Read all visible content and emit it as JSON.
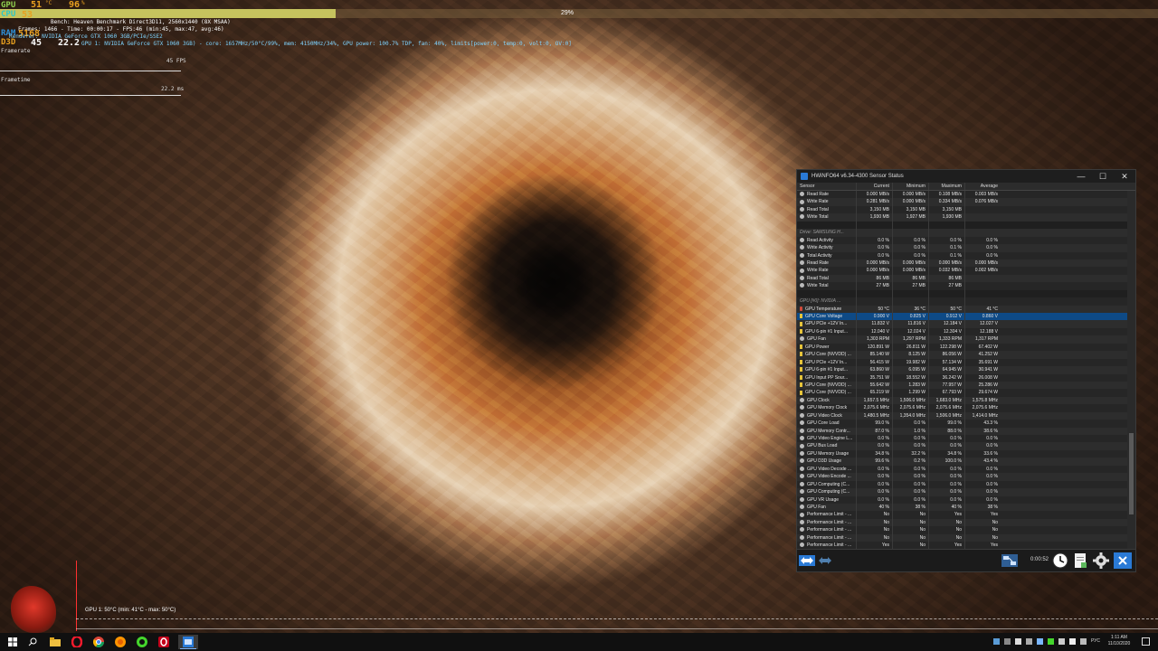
{
  "osd": {
    "gpu_label": "GPU",
    "gpu_value": "51",
    "gpu_unit": "°C",
    "gpu_value2": "96",
    "gpu_unit2": "%",
    "cpu_label": "CPU",
    "cpu_value": "53",
    "ram_label": "RAM",
    "ram_value": "5168",
    "fps_label": "D3D",
    "fps_value": "45",
    "fps_unit": "FPS",
    "frametime": "22.2",
    "frametime_unit": "ms",
    "line1": "Bench: Heaven Benchmark Direct3D11, 2560x1440 (8X MSAA)",
    "line2": "Frames: 1466 - Time: 00:00:17 - FPS:46 (min:45, max:47, avg:46)",
    "line3": "Renderer: NVIDIA GeForce GTX 1060 3GB/PCIe/SSE2",
    "line4": "GPU 1: NVIDIA GeForce GTX 1060 3GB) - core: 1657MHz/50°C/99%, mem: 4150MHz/34%, GPU power: 100.7% TDP, fan: 40%, limits[power:0, temp:0, volt:0, OV:0]",
    "framerate_label": "Framerate",
    "framerate_max": "45 FPS",
    "frametime_label": "Frametime",
    "frametime_max": "22.2 ms",
    "progress_pct": 29,
    "progress_label": "29%",
    "gpu_graph_label": "GPU 1: 50°C (min: 41°C - max: 50°C)"
  },
  "hwinfo": {
    "title": "HWiNFO64 v6.34-4300 Sensor Status",
    "controls": {
      "minimize": "—",
      "maximize": "☐",
      "close": "✕"
    },
    "columns": [
      "Sensor",
      "Current",
      "Minimum",
      "Maximum",
      "Average"
    ],
    "rows": [
      {
        "t": "d",
        "n": "Read Rate",
        "v": [
          "0.000 MB/s",
          "0.000 MB/s",
          "0.108 MB/s",
          "0.003 MB/s"
        ]
      },
      {
        "t": "d",
        "n": "Write Rate",
        "v": [
          "0.281 MB/s",
          "0.000 MB/s",
          "0.334 MB/s",
          "0.076 MB/s"
        ]
      },
      {
        "t": "d",
        "n": "Read Total",
        "v": [
          "3,150 MB",
          "3,150 MB",
          "3,150 MB",
          ""
        ]
      },
      {
        "t": "d",
        "n": "Write Total",
        "v": [
          "1,930 MB",
          "1,927 MB",
          "1,930 MB",
          ""
        ]
      },
      {
        "t": "b",
        "n": "",
        "v": [
          "",
          "",
          "",
          ""
        ]
      },
      {
        "t": "g",
        "n": "Drive: SAMSUNG H...",
        "v": [
          "",
          "",
          "",
          ""
        ]
      },
      {
        "t": "d",
        "n": "Read Activity",
        "v": [
          "0.0 %",
          "0.0 %",
          "0.0 %",
          "0.0 %"
        ]
      },
      {
        "t": "d",
        "n": "Write Activity",
        "v": [
          "0.0 %",
          "0.0 %",
          "0.1 %",
          "0.0 %"
        ]
      },
      {
        "t": "d",
        "n": "Total Activity",
        "v": [
          "0.0 %",
          "0.0 %",
          "0.1 %",
          "0.0 %"
        ]
      },
      {
        "t": "d",
        "n": "Read Rate",
        "v": [
          "0.000 MB/s",
          "0.000 MB/s",
          "0.000 MB/s",
          "0.000 MB/s"
        ]
      },
      {
        "t": "d",
        "n": "Write Rate",
        "v": [
          "0.000 MB/s",
          "0.000 MB/s",
          "0.032 MB/s",
          "0.002 MB/s"
        ]
      },
      {
        "t": "d",
        "n": "Read Total",
        "v": [
          "86 MB",
          "86 MB",
          "86 MB",
          ""
        ]
      },
      {
        "t": "d",
        "n": "Write Total",
        "v": [
          "27 MB",
          "27 MB",
          "27 MB",
          ""
        ]
      },
      {
        "t": "b",
        "n": "",
        "v": [
          "",
          "",
          "",
          ""
        ]
      },
      {
        "t": "g",
        "n": "GPU [#0]: NVIDIA ...",
        "v": [
          "",
          "",
          "",
          ""
        ]
      },
      {
        "t": "t",
        "n": "GPU Temperature",
        "v": [
          "50 °C",
          "36 °C",
          "50 °C",
          "41 °C"
        ]
      },
      {
        "t": "s",
        "n": "GPU Core Voltage",
        "v": [
          "0.900 V",
          "0.825 V",
          "0.912 V",
          "0.860 V"
        ]
      },
      {
        "t": "v",
        "n": "GPU PCIe +12V In...",
        "v": [
          "11.832 V",
          "11.816 V",
          "12.184 V",
          "12.027 V"
        ]
      },
      {
        "t": "v",
        "n": "GPU 6-pin #1 Input...",
        "v": [
          "12.040 V",
          "12.024 V",
          "12.304 V",
          "12.188 V"
        ]
      },
      {
        "t": "d",
        "n": "GPU Fan",
        "v": [
          "1,303 RPM",
          "1,297 RPM",
          "1,333 RPM",
          "1,317 RPM"
        ]
      },
      {
        "t": "v",
        "n": "GPU Power",
        "v": [
          "120.891 W",
          "26.811 W",
          "122.298 W",
          "67.402 W"
        ]
      },
      {
        "t": "v",
        "n": "GPU Core (NVVDD) ...",
        "v": [
          "85.140 W",
          "8.125 W",
          "86.056 W",
          "41.252 W"
        ]
      },
      {
        "t": "v",
        "n": "GPU PCIe +12V In...",
        "v": [
          "56.415 W",
          "19.982 W",
          "57.134 W",
          "35.691 W"
        ]
      },
      {
        "t": "v",
        "n": "GPU 6-pin #1 Input...",
        "v": [
          "63.860 W",
          "6.095 W",
          "64.945 W",
          "30.941 W"
        ]
      },
      {
        "t": "v",
        "n": "GPU Input PP Sour...",
        "v": [
          "35.751 W",
          "18.552 W",
          "36.242 W",
          "26.008 W"
        ]
      },
      {
        "t": "v",
        "n": "GPU Core (NVVDD) ...",
        "v": [
          "55.642 W",
          "1.283 W",
          "77.957 W",
          "25.286 W"
        ]
      },
      {
        "t": "v",
        "n": "GPU Core (NVVDD) ...",
        "v": [
          "65.219 W",
          "1.299 W",
          "67.793 W",
          "29.674 W"
        ]
      },
      {
        "t": "d",
        "n": "GPU Clock",
        "v": [
          "1,657.5 MHz",
          "1,506.0 MHz",
          "1,683.0 MHz",
          "1,575.8 MHz"
        ]
      },
      {
        "t": "d",
        "n": "GPU Memory Clock",
        "v": [
          "2,075.6 MHz",
          "2,075.6 MHz",
          "2,075.6 MHz",
          "2,075.6 MHz"
        ]
      },
      {
        "t": "d",
        "n": "GPU Video Clock",
        "v": [
          "1,480.5 MHz",
          "1,354.0 MHz",
          "1,506.0 MHz",
          "1,414.0 MHz"
        ]
      },
      {
        "t": "d",
        "n": "GPU Core Load",
        "v": [
          "99.0 %",
          "0.0 %",
          "99.0 %",
          "43.3 %"
        ]
      },
      {
        "t": "d",
        "n": "GPU Memory Contr...",
        "v": [
          "87.0 %",
          "1.0 %",
          "88.0 %",
          "38.6 %"
        ]
      },
      {
        "t": "d",
        "n": "GPU Video Engine L...",
        "v": [
          "0.0 %",
          "0.0 %",
          "0.0 %",
          "0.0 %"
        ]
      },
      {
        "t": "d",
        "n": "GPU Bus Load",
        "v": [
          "0.0 %",
          "0.0 %",
          "0.0 %",
          "0.0 %"
        ]
      },
      {
        "t": "d",
        "n": "GPU Memory Usage",
        "v": [
          "34.8 %",
          "32.2 %",
          "34.8 %",
          "33.6 %"
        ]
      },
      {
        "t": "d",
        "n": "GPU D3D Usage",
        "v": [
          "99.6 %",
          "0.2 %",
          "100.0 %",
          "43.4 %"
        ]
      },
      {
        "t": "d",
        "n": "GPU Video Decode ...",
        "v": [
          "0.0 %",
          "0.0 %",
          "0.0 %",
          "0.0 %"
        ]
      },
      {
        "t": "d",
        "n": "GPU Video Encode ...",
        "v": [
          "0.0 %",
          "0.0 %",
          "0.0 %",
          "0.0 %"
        ]
      },
      {
        "t": "d",
        "n": "GPU Computing (C...",
        "v": [
          "0.0 %",
          "0.0 %",
          "0.0 %",
          "0.0 %"
        ]
      },
      {
        "t": "d",
        "n": "GPU Computing (C...",
        "v": [
          "0.0 %",
          "0.0 %",
          "0.0 %",
          "0.0 %"
        ]
      },
      {
        "t": "d",
        "n": "GPU VR Usage",
        "v": [
          "0.0 %",
          "0.0 %",
          "0.0 %",
          "0.0 %"
        ]
      },
      {
        "t": "d",
        "n": "GPU Fan",
        "v": [
          "40 %",
          "38 %",
          "40 %",
          "38 %"
        ]
      },
      {
        "t": "d",
        "n": "Performance Limit - ...",
        "v": [
          "No",
          "No",
          "Yes",
          "Yes"
        ]
      },
      {
        "t": "d",
        "n": "Performance Limit - ...",
        "v": [
          "No",
          "No",
          "No",
          "No"
        ]
      },
      {
        "t": "d",
        "n": "Performance Limit - ...",
        "v": [
          "No",
          "No",
          "No",
          "No"
        ]
      },
      {
        "t": "d",
        "n": "Performance Limit - ...",
        "v": [
          "No",
          "No",
          "No",
          "No"
        ]
      },
      {
        "t": "d",
        "n": "Performance Limit - ...",
        "v": [
          "Yes",
          "No",
          "Yes",
          "Yes"
        ]
      }
    ],
    "timer": "0:00:52"
  },
  "taskbar": {
    "apps": [
      "windows-start",
      "search",
      "file-explorer",
      "opera",
      "chrome",
      "firefox",
      "razer",
      "opera-gx",
      "hwinfo"
    ],
    "lang": "РУС",
    "time": "1:11 AM",
    "date": "11/10/2020"
  },
  "colors": {
    "accent": "#2a7ad6",
    "osd_orange": "#e8a020",
    "osd_green": "#8fd14f",
    "progress": "#c6c35e"
  }
}
